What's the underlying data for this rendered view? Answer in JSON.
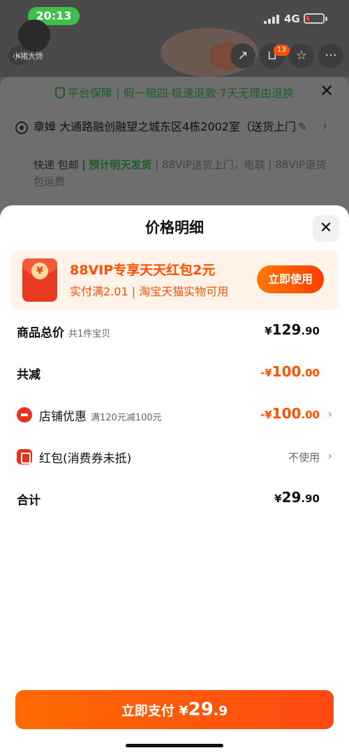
{
  "status_bar": {
    "time": "20:13",
    "network": "4G"
  },
  "header": {
    "logo_text": "小猪大馋",
    "cart_count": "13"
  },
  "background_sheet": {
    "guarantee": "平台保障 | 假一赔四·极速退款·7天无理由退换",
    "address": "章嫜 大通路融创融望之城东区4栋2002室（送货上门",
    "ship_prefix": "快递 包邮 | ",
    "ship_highlight": "预计明天发货",
    "ship_suffix": " | 88VIP送货上门，电联 | 88VIP退货包运费"
  },
  "sheet": {
    "title": "价格明细",
    "promo": {
      "title": "88VIP专享天天红包2元",
      "subtitle": "实付满2.01 | 淘宝天猫实物可用",
      "coin_symbol": "¥",
      "button": "立即使用"
    },
    "rows": {
      "total": {
        "label": "商品总价",
        "note": "共1件宝贝",
        "currency": "¥",
        "int": "129",
        "dec": ".90"
      },
      "reduce": {
        "label": "共减",
        "currency": "-¥",
        "int": "100",
        "dec": ".00"
      },
      "shop": {
        "label": "店铺优惠",
        "note": "满120元减100元",
        "currency": "-¥",
        "int": "100",
        "dec": ".00"
      },
      "redpacket": {
        "label": "红包(消费券未抵)",
        "value": "不使用"
      },
      "sum": {
        "label": "合计",
        "currency": "¥",
        "int": "29",
        "dec": ".90"
      }
    },
    "pay_button": {
      "prefix": "立即支付",
      "currency": "¥",
      "int": "29",
      "dec": ".9"
    }
  },
  "colors": {
    "accent": "#ff5000",
    "green": "#1e5e2a",
    "sheet_bg": "#ffffff"
  }
}
